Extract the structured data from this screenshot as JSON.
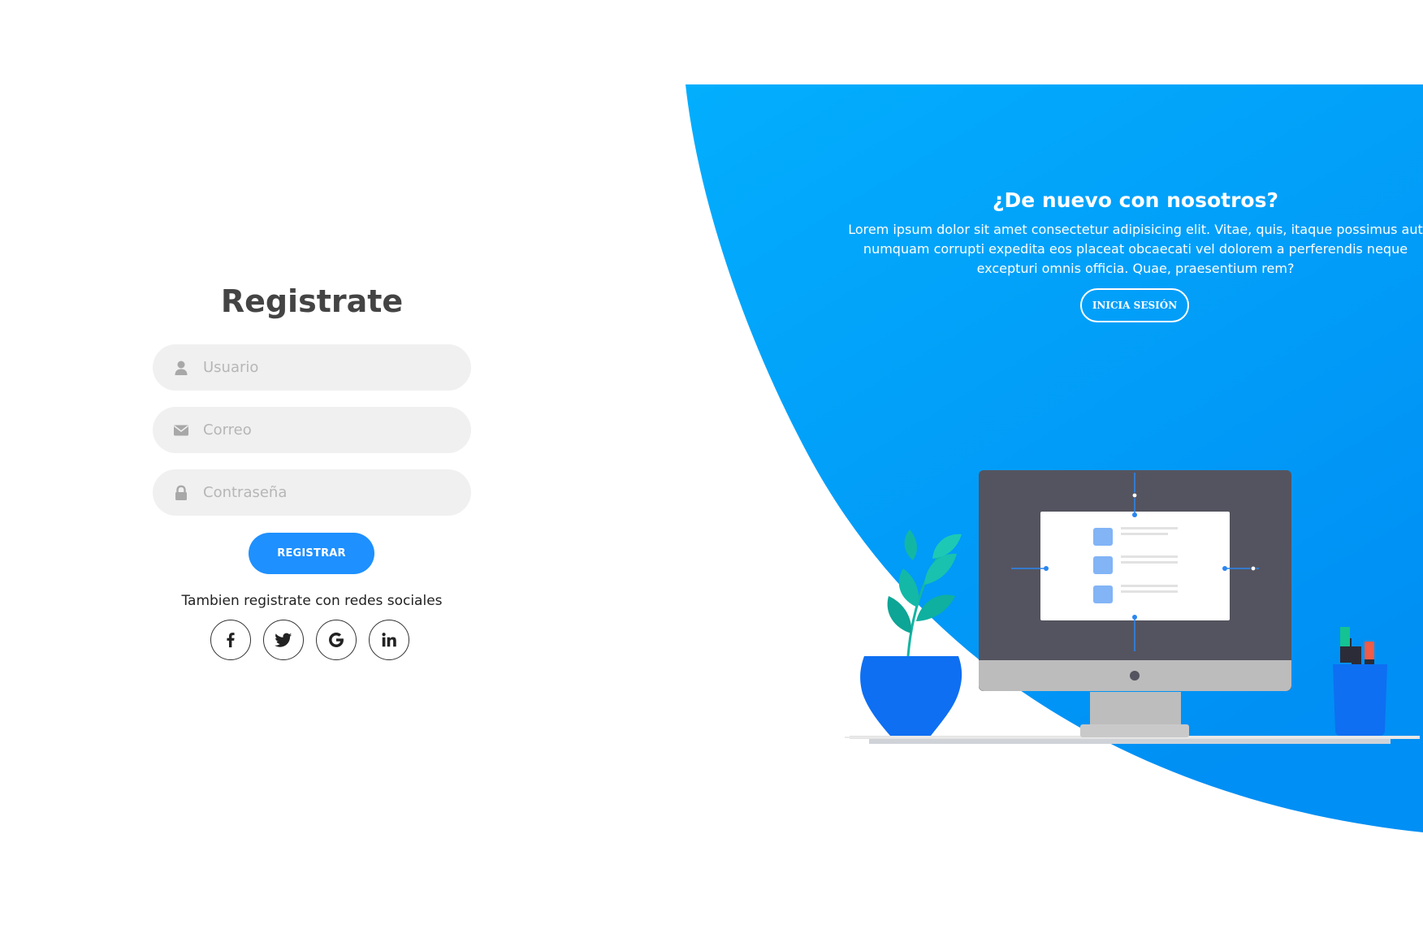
{
  "register": {
    "title": "Registrate",
    "fields": {
      "user_placeholder": "Usuario",
      "email_placeholder": "Correo",
      "password_placeholder": "Contraseña"
    },
    "submit_label": "REGISTRAR",
    "social_text": "Tambien registrate con redes sociales",
    "social_icons": [
      "facebook-icon",
      "twitter-icon",
      "google-icon",
      "linkedin-icon"
    ]
  },
  "panel": {
    "title": "¿De nuevo con nosotros?",
    "text": "Lorem ipsum dolor sit amet consectetur adipisicing elit. Vitae, quis, itaque possimus aut numquam corrupti expedita eos placeat obcaecati vel dolorem a perferendis neque excepturi omnis officia. Quae, praesentium rem?",
    "login_label": "INICIA SESIÓN"
  },
  "colors": {
    "accent": "#1e90ff",
    "panel_blue": "#03a6fb",
    "panel_blue_dark": "#0093f5",
    "input_bg": "#f0f0f0",
    "title_text": "#444444"
  }
}
